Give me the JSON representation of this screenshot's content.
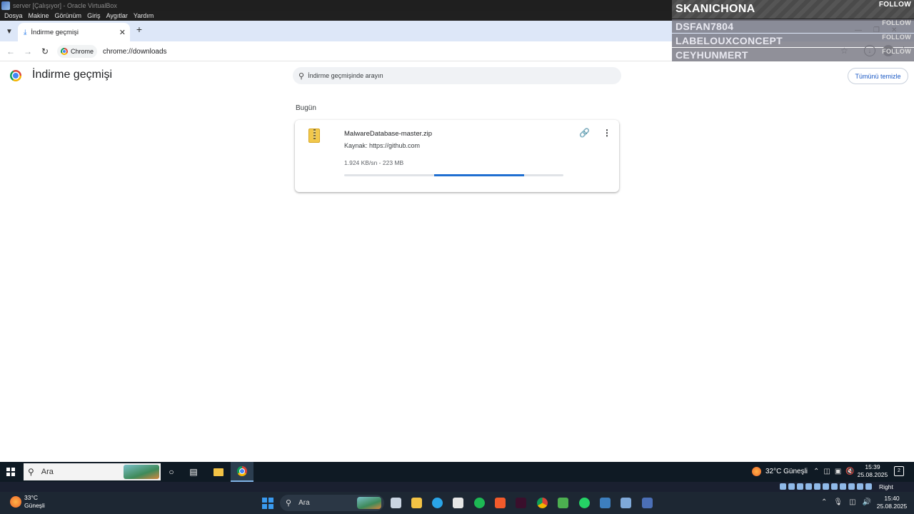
{
  "vbox": {
    "window_title": "server [Çalışıyor] - Oracle VirtualBox",
    "menu": [
      "Dosya",
      "Makine",
      "Görünüm",
      "Giriş",
      "Aygıtlar",
      "Yardım"
    ],
    "host_key": "Right Control"
  },
  "overlay": {
    "follow_label": "FOLLOW",
    "followers": [
      "SKANICHONA",
      "DSFAN7804",
      "LABELOUXCONCEPT",
      "CEYHUNMERT"
    ]
  },
  "browser": {
    "tab_title": "İndirme geçmişi",
    "chip_label": "Chrome",
    "url": "chrome://downloads"
  },
  "downloads": {
    "page_title": "İndirme geçmişi",
    "search_placeholder": "İndirme geçmişinde arayın",
    "clear_all_label": "Tümünü temizle",
    "date_header": "Bugün",
    "items": [
      {
        "file_name": "MalwareDatabase-master.zip",
        "source": "Kaynak: https://github.com",
        "status": "1.924 KB/sn - 223 MB",
        "progress_fraction": 0.41
      }
    ]
  },
  "guest_taskbar": {
    "search_label": "Ara",
    "weather": "32°C  Güneşli",
    "time": "15:39",
    "date": "25.08.2025",
    "notification_count": "2"
  },
  "host_taskbar": {
    "temperature": "33°C",
    "condition": "Güneşli",
    "search_label": "Ara",
    "time": "15:40",
    "date": "25.08.2025"
  },
  "colors": {
    "accent_blue": "#1f6fd1",
    "tabstrip": "#dde7f8",
    "taskbar": "#0f1a24"
  }
}
